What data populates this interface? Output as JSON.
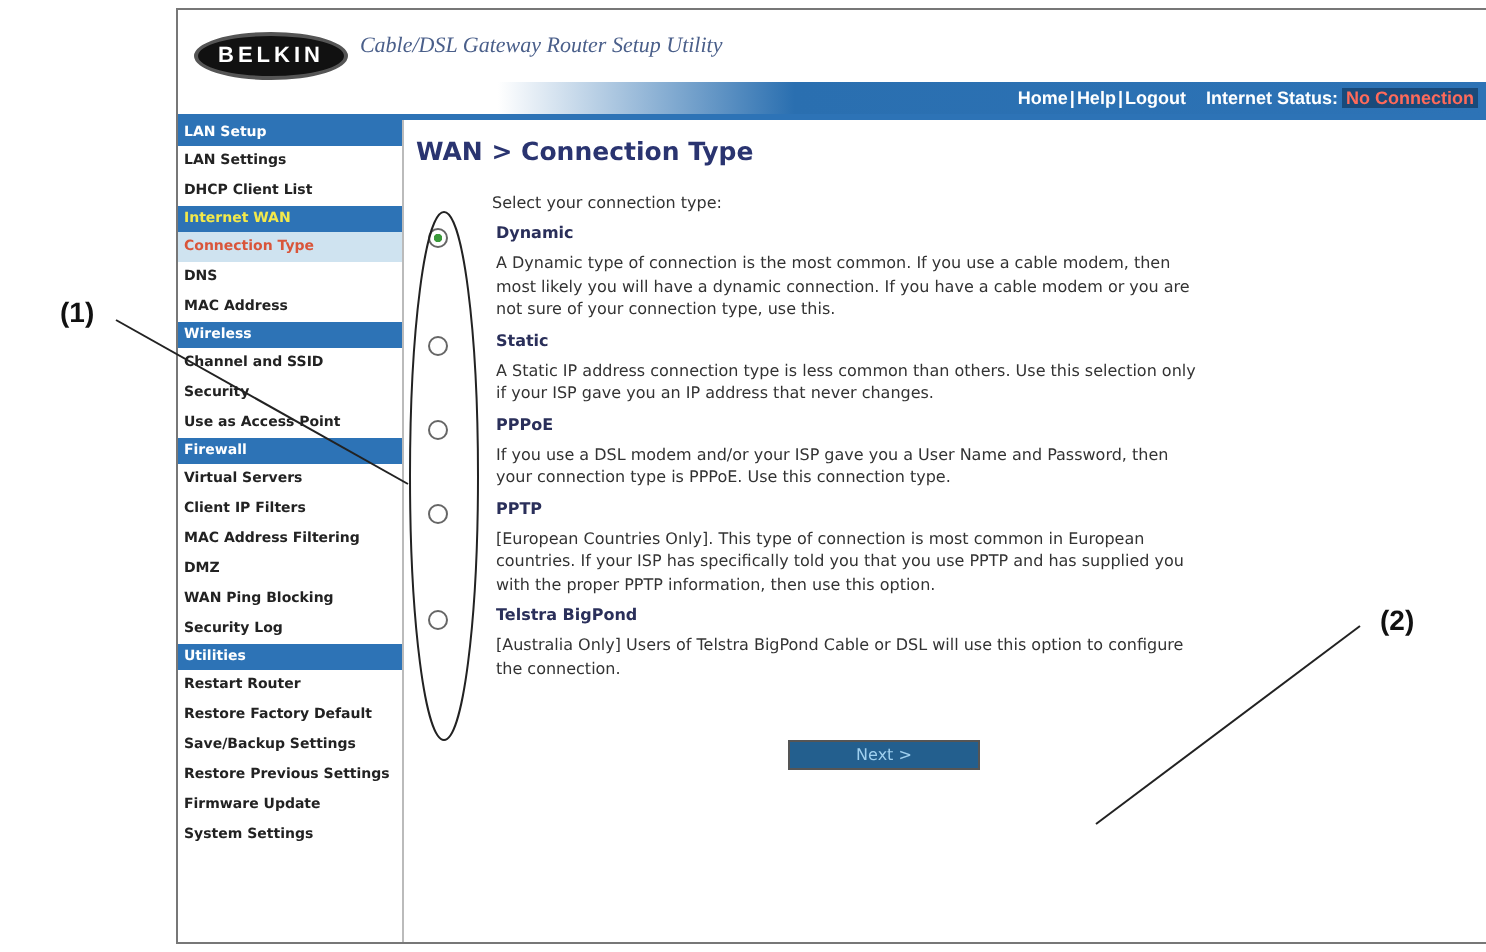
{
  "header": {
    "logo": "BELKIN",
    "tagline": "Cable/DSL Gateway Router Setup Utility",
    "links": [
      "Home",
      "Help",
      "Logout"
    ],
    "separator": "|",
    "status_label": "Internet Status:",
    "status_value": "No Connection"
  },
  "sidebar": [
    {
      "title": "LAN Setup",
      "items": [
        {
          "label": "LAN Settings",
          "selected": false
        },
        {
          "label": "DHCP Client List",
          "selected": false
        }
      ]
    },
    {
      "title": "Internet WAN",
      "items": [
        {
          "label": "Connection Type",
          "selected": true
        },
        {
          "label": "DNS",
          "selected": false
        },
        {
          "label": "MAC Address",
          "selected": false
        }
      ]
    },
    {
      "title": "Wireless",
      "items": [
        {
          "label": "Channel and SSID",
          "selected": false
        },
        {
          "label": "Security",
          "selected": false
        },
        {
          "label": "Use as Access Point",
          "selected": false
        }
      ]
    },
    {
      "title": "Firewall",
      "items": [
        {
          "label": "Virtual Servers",
          "selected": false
        },
        {
          "label": "Client IP Filters",
          "selected": false
        },
        {
          "label": "MAC Address Filtering",
          "selected": false
        },
        {
          "label": "DMZ",
          "selected": false
        },
        {
          "label": "WAN Ping Blocking",
          "selected": false
        },
        {
          "label": "Security Log",
          "selected": false
        }
      ]
    },
    {
      "title": "Utilities",
      "items": [
        {
          "label": "Restart Router",
          "selected": false
        },
        {
          "label": "Restore Factory Default",
          "selected": false
        },
        {
          "label": "Save/Backup Settings",
          "selected": false
        },
        {
          "label": "Restore Previous Settings",
          "selected": false
        },
        {
          "label": "Firmware Update",
          "selected": false
        },
        {
          "label": "System Settings",
          "selected": false
        }
      ]
    }
  ],
  "page_title": "WAN > Connection Type",
  "prompt": "Select your connection type:",
  "options": [
    {
      "title": "Dynamic",
      "selected": true,
      "description": "A Dynamic type of connection is the most common. If you use a cable modem, then most likely you will have a dynamic connection. If you have a cable modem or you are not sure of your connection type, use this."
    },
    {
      "title": "Static",
      "selected": false,
      "description": "A Static IP address connection type is less common than others. Use this selection only if your ISP gave you an IP address that never changes."
    },
    {
      "title": "PPPoE",
      "selected": false,
      "description": "If you use a DSL modem and/or your ISP gave you a User Name and Password, then your connection type is PPPoE. Use this connection type."
    },
    {
      "title": "PPTP",
      "selected": false,
      "description": "[European Countries Only]. This type of connection is most common in European countries. If your ISP has specifically told you that you use PPTP and has supplied you with the proper PPTP information, then use this option."
    },
    {
      "title": "Telstra BigPond",
      "selected": false,
      "description": "[Australia Only] Users of Telstra BigPond Cable or DSL will use this option to configure the connection."
    }
  ],
  "next_button": "Next >",
  "callouts": [
    "(1)",
    "(2)"
  ]
}
